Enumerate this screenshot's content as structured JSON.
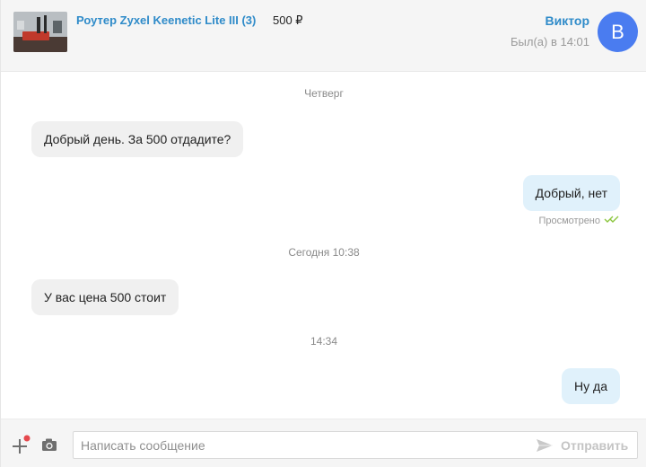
{
  "header": {
    "listing_title": "Роутер Zyxel Keenetic Lite III (3)",
    "listing_price": "500 ₽",
    "user_name": "Виктор",
    "last_seen": "Был(а) в 14:01",
    "avatar_letter": "В",
    "avatar_color": "#4a7cf0",
    "link_color": "#2f8bc9"
  },
  "messages": {
    "sep_thursday": "Четверг",
    "msg1": "Добрый день. За 500 отдадите?",
    "msg2": "Добрый, нет",
    "msg2_status": "Просмотрено",
    "sep_today": "Сегодня 10:38",
    "msg3": "У вас цена 500 стоит",
    "sep_time": "14:34",
    "msg4": "Ну да"
  },
  "composer": {
    "placeholder": "Написать сообщение",
    "send_label": "Отправить",
    "attach_icon": "plus-icon",
    "camera_icon": "camera-icon",
    "send_icon": "paper-plane-icon",
    "notification_dot_color": "#e5484d"
  },
  "colors": {
    "incoming_bubble": "#f0f0f0",
    "outgoing_bubble": "#e0f1fb",
    "read_check": "#8cc63f"
  }
}
